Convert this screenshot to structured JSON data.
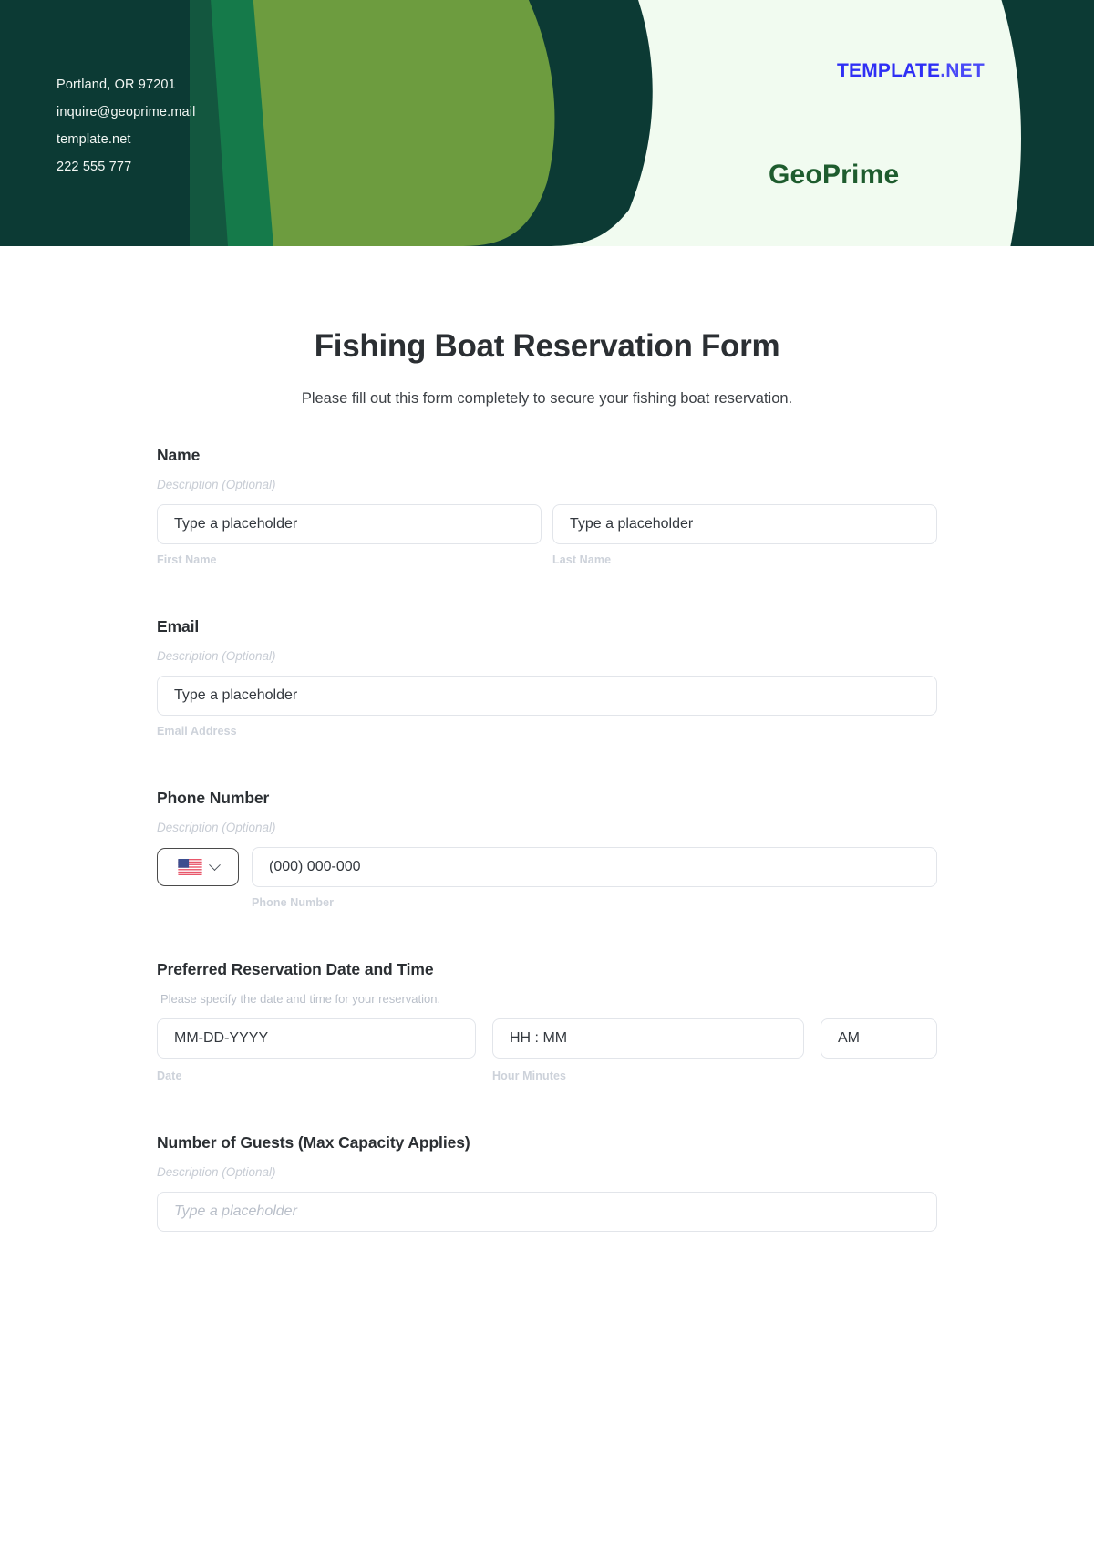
{
  "header": {
    "contact": [
      "Portland, OR 97201",
      "inquire@geoprime.mail",
      "template.net",
      "222 555 777"
    ],
    "watermark_main": "TEMPLATE",
    "watermark_suffix": ".NET",
    "brand": "GeoPrime",
    "colors": {
      "dark_teal": "#0c3a34",
      "mid_green": "#157a4a",
      "olive_green": "#6d9c3f",
      "cream": "#f1fbf0",
      "brand_green": "#1e5c2e",
      "watermark_blue": "#2f2ff5"
    }
  },
  "form": {
    "title": "Fishing Boat Reservation Form",
    "subtitle": "Please fill out this form completely to secure your fishing boat reservation.",
    "description_optional": "Description (Optional)",
    "placeholder": "Type a placeholder",
    "fields": {
      "name": {
        "label": "Name",
        "description": "Description (Optional)",
        "first_placeholder": "Type a placeholder",
        "last_placeholder": "Type a placeholder",
        "first_sublabel": "First Name",
        "last_sublabel": "Last Name"
      },
      "email": {
        "label": "Email",
        "description": "Description (Optional)",
        "placeholder": "Type a placeholder",
        "sublabel": "Email Address"
      },
      "phone": {
        "label": "Phone Number",
        "description": "Description (Optional)",
        "country_flag": "us-flag-icon",
        "placeholder": "(000) 000-000",
        "sublabel": "Phone Number"
      },
      "datetime": {
        "label": "Preferred Reservation Date and Time",
        "description": "Please specify the date and time for your reservation.",
        "date_placeholder": "MM-DD-YYYY",
        "time_placeholder": "HH : MM",
        "meridiem_value": "AM",
        "date_sublabel": "Date",
        "time_sublabel": "Hour Minutes"
      },
      "guests": {
        "label": "Number of Guests (Max Capacity Applies)",
        "description": "Description (Optional)",
        "placeholder": "Type a placeholder"
      }
    }
  }
}
